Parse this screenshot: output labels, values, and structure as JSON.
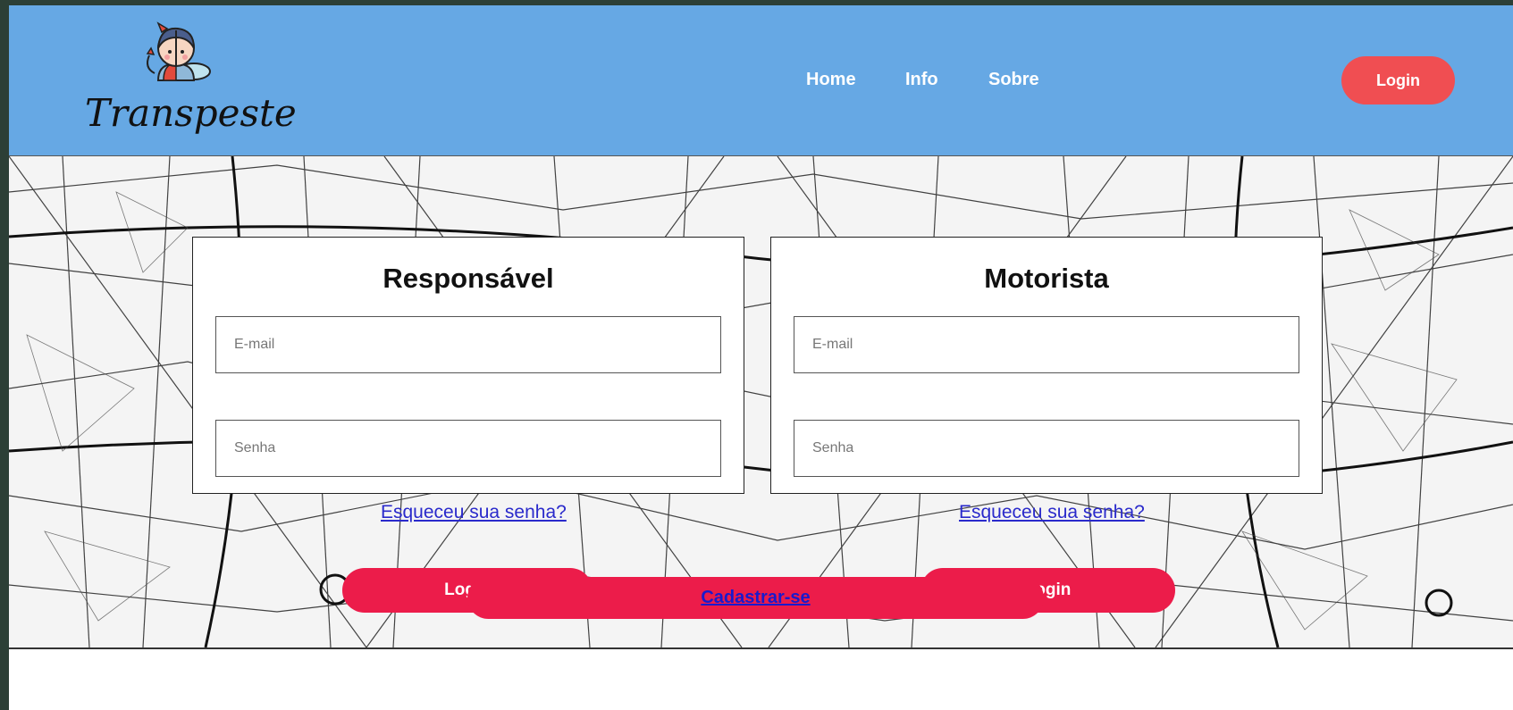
{
  "brand": {
    "name": "Transpeste"
  },
  "nav": {
    "home": "Home",
    "info": "Info",
    "sobre": "Sobre",
    "login": "Login"
  },
  "responsavel": {
    "title": "Responsável",
    "email_placeholder": "E-mail",
    "senha_placeholder": "Senha",
    "forgot": "Esqueceu sua senha?",
    "login_label": "Login"
  },
  "motorista": {
    "title": "Motorista",
    "email_placeholder": "E-mail",
    "senha_placeholder": "Senha",
    "forgot": "Esqueceu sua senha?",
    "login_label": "Login"
  },
  "cadastro": {
    "label": "Cadastrar-se"
  },
  "colors": {
    "header": "#66a8e4",
    "accent": "#f04e52",
    "button": "#ec1c4a",
    "link": "#2a2acb"
  }
}
